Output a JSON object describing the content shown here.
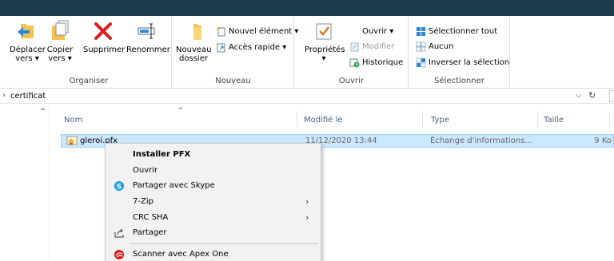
{
  "ribbon": {
    "organiser": {
      "label": "Organiser",
      "move": {
        "line1": "Déplacer",
        "line2": "vers ▾"
      },
      "copy": {
        "line1": "Copier",
        "line2": "vers ▾"
      },
      "delete": "Supprimer",
      "rename": "Renommer"
    },
    "nouveau": {
      "label": "Nouveau",
      "new_folder": {
        "line1": "Nouveau",
        "line2": "dossier"
      },
      "new_item": "Nouvel élément ▾",
      "quick_access": "Accès rapide ▾"
    },
    "ouvrir": {
      "label": "Ouvrir",
      "properties": {
        "line1": "Propriétés",
        "line2": "▾"
      },
      "open": "Ouvrir ▾",
      "edit": "Modifier",
      "history": "Historique"
    },
    "selectionner": {
      "label": "Sélectionner",
      "select_all": "Sélectionner tout",
      "select_none": "Aucun",
      "invert": "Inverser la sélection"
    }
  },
  "address": {
    "arrow": "›",
    "path": "certificat",
    "chevron": "⌵",
    "refresh": "↻"
  },
  "columns": {
    "name": "Nom",
    "modified": "Modifié le",
    "type": "Type",
    "size": "Taille",
    "sort": "^"
  },
  "file": {
    "name": "gleroi.pfx",
    "modified": "11/12/2020 13:44",
    "type": "Échange d'informations...",
    "size": "9 Ko"
  },
  "context_menu": {
    "items": [
      {
        "label": "Installer PFX"
      },
      {
        "label": "Ouvrir"
      },
      {
        "label": "Partager avec Skype"
      },
      {
        "label": "7-Zip",
        "submenu": "›"
      },
      {
        "label": "CRC SHA",
        "submenu": "›"
      },
      {
        "label": "Partager"
      },
      {
        "label": "Scanner avec Apex One"
      }
    ]
  },
  "colors": {
    "accent": "#0078d7",
    "selection": "#cce8ff",
    "titlebar": "#1e3a4e"
  }
}
